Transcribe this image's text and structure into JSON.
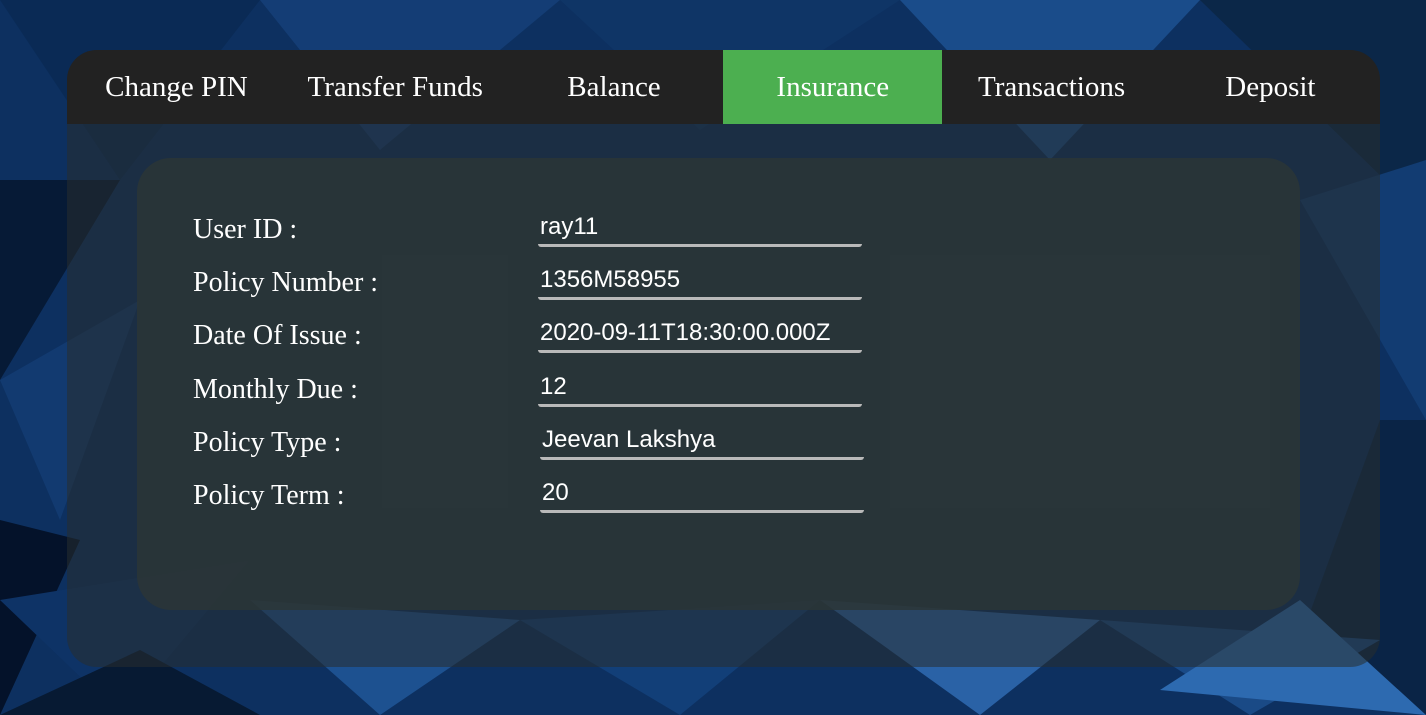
{
  "nav": {
    "tabs": [
      {
        "label": "Change PIN"
      },
      {
        "label": "Transfer Funds"
      },
      {
        "label": "Balance"
      },
      {
        "label": "Insurance",
        "active": true
      },
      {
        "label": "Transactions"
      },
      {
        "label": "Deposit"
      }
    ],
    "active_color": "#4caf50"
  },
  "form": {
    "fields": [
      {
        "label": "User ID :",
        "value": "ray11"
      },
      {
        "label": "Policy Number :",
        "value": "1356M58955"
      },
      {
        "label": "Date Of Issue :",
        "value": "2020-09-11T18:30:00.000Z"
      },
      {
        "label": "Monthly Due :",
        "value": "12"
      },
      {
        "label": "Policy Type :",
        "value": "Jeevan Lakshya"
      },
      {
        "label": "Policy Term :",
        "value": "20"
      }
    ]
  }
}
